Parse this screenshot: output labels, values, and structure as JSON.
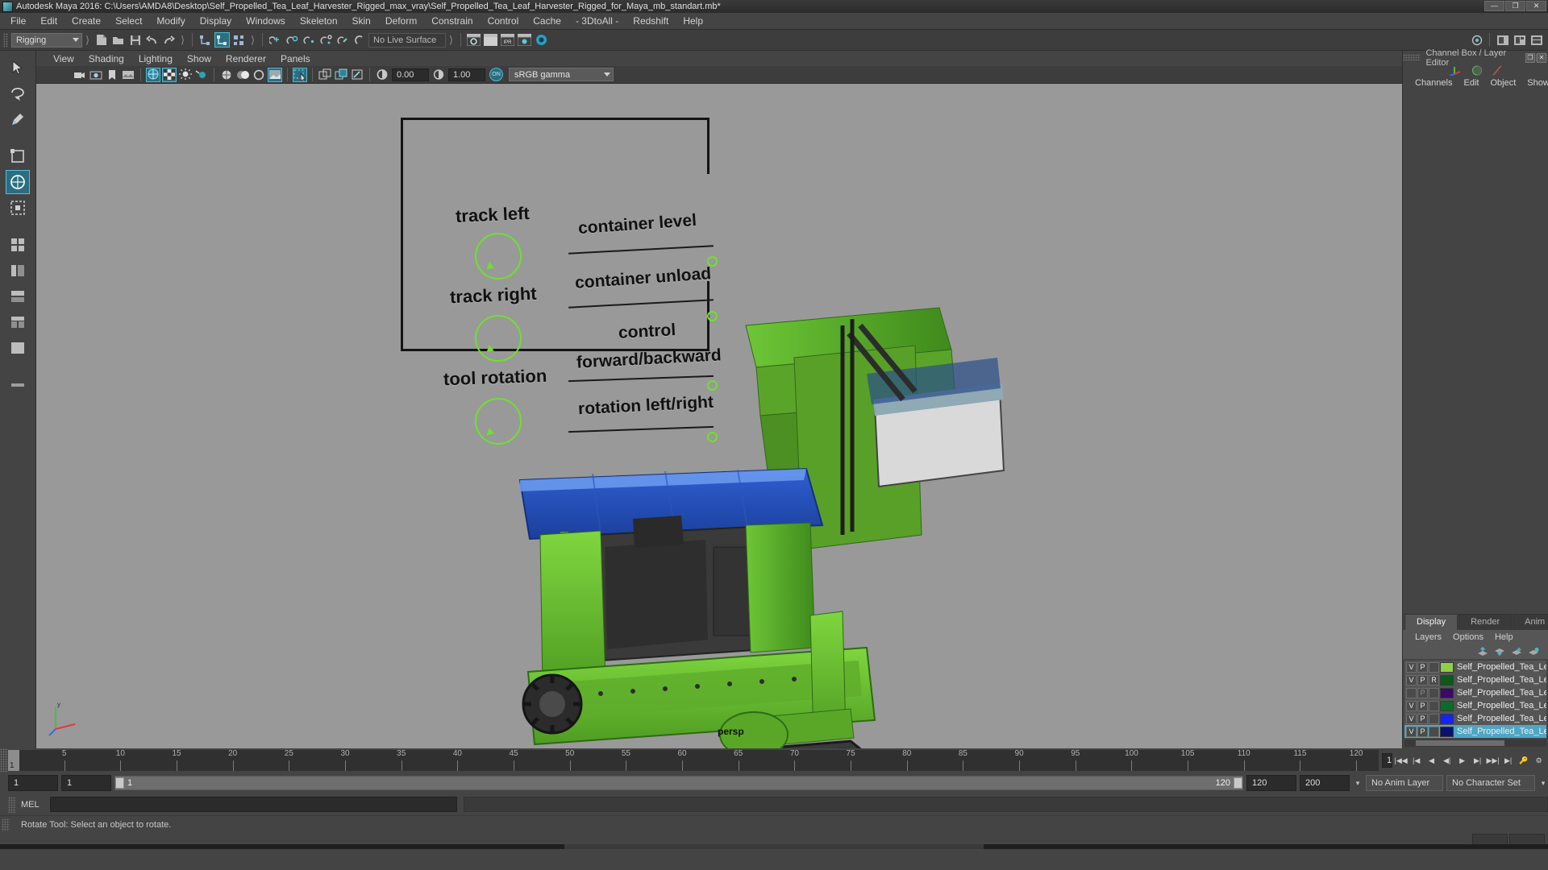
{
  "window": {
    "title": "Autodesk Maya 2016: C:\\Users\\AMDA8\\Desktop\\Self_Propelled_Tea_Leaf_Harvester_Rigged_max_vray\\Self_Propelled_Tea_Leaf_Harvester_Rigged_for_Maya_mb_standart.mb*",
    "minimize": "—",
    "maximize": "❐",
    "close": "✕"
  },
  "menubar": {
    "items": [
      "File",
      "Edit",
      "Create",
      "Select",
      "Modify",
      "Display",
      "Windows",
      "Skeleton",
      "Skin",
      "Deform",
      "Constrain",
      "Control",
      "Cache",
      "- 3DtoAll -",
      "Redshift",
      "Help"
    ]
  },
  "statusline": {
    "mode": "Rigging",
    "live_surface": "No Live Surface"
  },
  "viewport_menu": {
    "items": [
      "View",
      "Shading",
      "Lighting",
      "Show",
      "Renderer",
      "Panels"
    ]
  },
  "viewport_toolbar": {
    "exposure": "0.00",
    "gamma_value": "1.00",
    "color_badge": "ON",
    "color_profile": "sRGB gamma"
  },
  "viewport": {
    "camera_label": "persp",
    "annotations": {
      "left_labels": [
        "track left",
        "track right",
        "tool rotation"
      ],
      "right_labels": [
        "container level",
        "container unload",
        "control",
        "forward/backward",
        "rotation left/right"
      ]
    }
  },
  "channel_box": {
    "title": "Channel Box / Layer Editor",
    "menu": [
      "Channels",
      "Edit",
      "Object",
      "Show"
    ]
  },
  "layer_editor": {
    "tabs": [
      "Display",
      "Render",
      "Anim"
    ],
    "active_tab": "Display",
    "menu": [
      "Layers",
      "Options",
      "Help"
    ],
    "rows": [
      {
        "v": "V",
        "p": "P",
        "third": "",
        "color": "#8ed04a",
        "name": "Self_Propelled_Tea_Leaf_H",
        "selected": false,
        "dim": false
      },
      {
        "v": "V",
        "p": "P",
        "third": "R",
        "color": "#0b5a1c",
        "name": "Self_Propelled_Tea_Leaf_Harv",
        "selected": false,
        "dim": false
      },
      {
        "v": "",
        "p": "P",
        "third": "",
        "color": "#3a0a6b",
        "name": "Self_Propelled_Tea_Leaf_Harv",
        "selected": false,
        "dim": true
      },
      {
        "v": "V",
        "p": "P",
        "third": "",
        "color": "#0c6b2a",
        "name": "Self_Propelled_Tea_Lea",
        "selected": false,
        "dim": false
      },
      {
        "v": "V",
        "p": "P",
        "third": "",
        "color": "#1723f0",
        "name": "Self_Propelled_Tea_Lea",
        "selected": false,
        "dim": false
      },
      {
        "v": "V",
        "p": "P",
        "third": "",
        "color": "#0b1170",
        "name": "Self_Propelled_Tea_Lea",
        "selected": true,
        "dim": false
      }
    ]
  },
  "timeline": {
    "current_frame": "1",
    "ticks": [
      5,
      10,
      15,
      20,
      25,
      30,
      35,
      40,
      45,
      50,
      55,
      60,
      65,
      70,
      75,
      80,
      85,
      90,
      95,
      100,
      105,
      110,
      115,
      120
    ],
    "field_frame": "1",
    "range_start": "1",
    "range_start2": "1",
    "range_bar_start": "1",
    "range_bar_end": "120",
    "range_end": "120",
    "playback_end": "200",
    "anim_layer": "No Anim Layer",
    "character_set": "No Character Set"
  },
  "command_line": {
    "label": "MEL",
    "input": ""
  },
  "status": {
    "help_text": "Rotate Tool: Select an object to rotate."
  }
}
